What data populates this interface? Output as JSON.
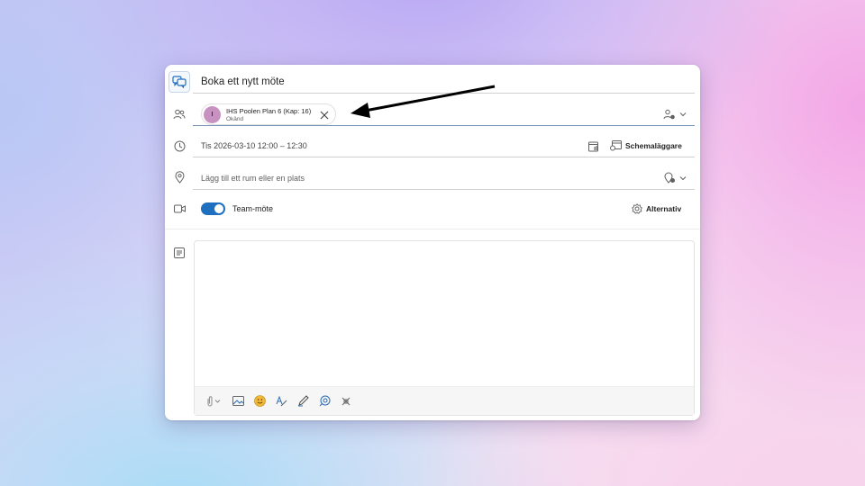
{
  "window": {
    "title": "Boka ett nytt möte",
    "attendee": {
      "initial": "I",
      "name": "IHS Poolen Plan 6 (Kap: 16)",
      "status": "Okänd"
    },
    "datetime": "Tis 2026-03-10 12:00 – 12:30",
    "scheduler_label": "Schemaläggare",
    "location_placeholder": "Lägg till ett rum eller en plats",
    "teams_label": "Team-möte",
    "teams_enabled": true,
    "options_label": "Alternativ",
    "body_text": ""
  },
  "icons": {
    "app": "chat-bubbles-icon",
    "attendees": "people-icon",
    "time": "clock-icon",
    "location": "location-pin-icon",
    "video": "video-camera-icon",
    "notes": "notes-icon",
    "toolbar": [
      "attach-icon",
      "image-icon",
      "emoji-icon",
      "editor-icon",
      "draw-icon",
      "loop-icon",
      "apps-icon"
    ]
  },
  "colors": {
    "accent": "#1f6fbf",
    "avatar": "#c792bf",
    "annotation_arrow": "#000000"
  }
}
